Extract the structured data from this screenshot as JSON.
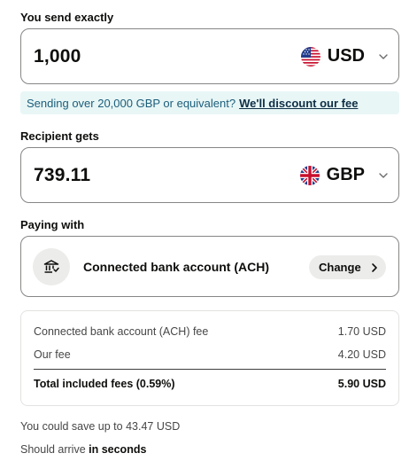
{
  "send": {
    "label": "You send exactly",
    "amount": "1,000",
    "currency": "USD",
    "flag_icon": "us-flag-icon"
  },
  "promo": {
    "text": "Sending over 20,000 GBP or equivalent?",
    "link": "We'll discount our fee"
  },
  "receive": {
    "label": "Recipient gets",
    "amount": "739.11",
    "currency": "GBP",
    "flag_icon": "uk-flag-icon"
  },
  "paying": {
    "label": "Paying with",
    "method": "Connected bank account (ACH)",
    "change_label": "Change",
    "icon": "bank-icon"
  },
  "fees": {
    "rows": [
      {
        "label": "Connected bank account (ACH) fee",
        "value": "1.70 USD"
      },
      {
        "label": "Our fee",
        "value": "4.20 USD"
      }
    ],
    "total_label": "Total included fees (0.59%)",
    "total_value": "5.90 USD"
  },
  "savings": "You could save up to 43.47 USD",
  "arrival": {
    "prefix": "Should arrive",
    "emphasis": "in seconds"
  },
  "colors": {
    "border": "#868685",
    "promo_bg": "#e8f6f6",
    "promo_text": "#1c5e7a",
    "chip_bg": "#ececea"
  }
}
